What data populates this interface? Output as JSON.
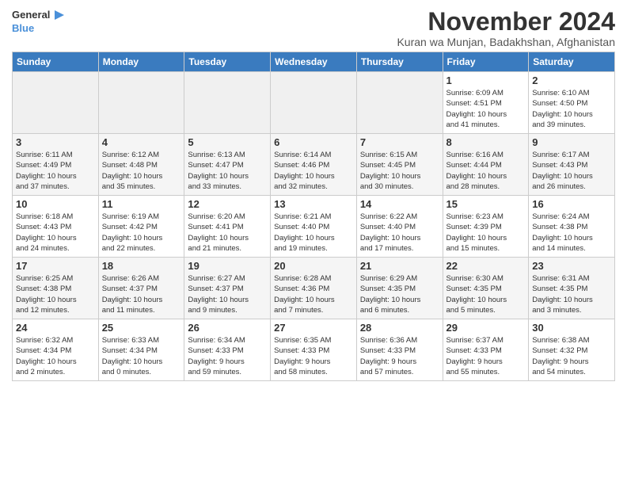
{
  "header": {
    "logo_general": "General",
    "logo_blue": "Blue",
    "month_title": "November 2024",
    "location": "Kuran wa Munjan, Badakhshan, Afghanistan"
  },
  "days_of_week": [
    "Sunday",
    "Monday",
    "Tuesday",
    "Wednesday",
    "Thursday",
    "Friday",
    "Saturday"
  ],
  "weeks": [
    [
      {
        "day": "",
        "info": ""
      },
      {
        "day": "",
        "info": ""
      },
      {
        "day": "",
        "info": ""
      },
      {
        "day": "",
        "info": ""
      },
      {
        "day": "",
        "info": ""
      },
      {
        "day": "1",
        "info": "Sunrise: 6:09 AM\nSunset: 4:51 PM\nDaylight: 10 hours\nand 41 minutes."
      },
      {
        "day": "2",
        "info": "Sunrise: 6:10 AM\nSunset: 4:50 PM\nDaylight: 10 hours\nand 39 minutes."
      }
    ],
    [
      {
        "day": "3",
        "info": "Sunrise: 6:11 AM\nSunset: 4:49 PM\nDaylight: 10 hours\nand 37 minutes."
      },
      {
        "day": "4",
        "info": "Sunrise: 6:12 AM\nSunset: 4:48 PM\nDaylight: 10 hours\nand 35 minutes."
      },
      {
        "day": "5",
        "info": "Sunrise: 6:13 AM\nSunset: 4:47 PM\nDaylight: 10 hours\nand 33 minutes."
      },
      {
        "day": "6",
        "info": "Sunrise: 6:14 AM\nSunset: 4:46 PM\nDaylight: 10 hours\nand 32 minutes."
      },
      {
        "day": "7",
        "info": "Sunrise: 6:15 AM\nSunset: 4:45 PM\nDaylight: 10 hours\nand 30 minutes."
      },
      {
        "day": "8",
        "info": "Sunrise: 6:16 AM\nSunset: 4:44 PM\nDaylight: 10 hours\nand 28 minutes."
      },
      {
        "day": "9",
        "info": "Sunrise: 6:17 AM\nSunset: 4:43 PM\nDaylight: 10 hours\nand 26 minutes."
      }
    ],
    [
      {
        "day": "10",
        "info": "Sunrise: 6:18 AM\nSunset: 4:43 PM\nDaylight: 10 hours\nand 24 minutes."
      },
      {
        "day": "11",
        "info": "Sunrise: 6:19 AM\nSunset: 4:42 PM\nDaylight: 10 hours\nand 22 minutes."
      },
      {
        "day": "12",
        "info": "Sunrise: 6:20 AM\nSunset: 4:41 PM\nDaylight: 10 hours\nand 21 minutes."
      },
      {
        "day": "13",
        "info": "Sunrise: 6:21 AM\nSunset: 4:40 PM\nDaylight: 10 hours\nand 19 minutes."
      },
      {
        "day": "14",
        "info": "Sunrise: 6:22 AM\nSunset: 4:40 PM\nDaylight: 10 hours\nand 17 minutes."
      },
      {
        "day": "15",
        "info": "Sunrise: 6:23 AM\nSunset: 4:39 PM\nDaylight: 10 hours\nand 15 minutes."
      },
      {
        "day": "16",
        "info": "Sunrise: 6:24 AM\nSunset: 4:38 PM\nDaylight: 10 hours\nand 14 minutes."
      }
    ],
    [
      {
        "day": "17",
        "info": "Sunrise: 6:25 AM\nSunset: 4:38 PM\nDaylight: 10 hours\nand 12 minutes."
      },
      {
        "day": "18",
        "info": "Sunrise: 6:26 AM\nSunset: 4:37 PM\nDaylight: 10 hours\nand 11 minutes."
      },
      {
        "day": "19",
        "info": "Sunrise: 6:27 AM\nSunset: 4:37 PM\nDaylight: 10 hours\nand 9 minutes."
      },
      {
        "day": "20",
        "info": "Sunrise: 6:28 AM\nSunset: 4:36 PM\nDaylight: 10 hours\nand 7 minutes."
      },
      {
        "day": "21",
        "info": "Sunrise: 6:29 AM\nSunset: 4:35 PM\nDaylight: 10 hours\nand 6 minutes."
      },
      {
        "day": "22",
        "info": "Sunrise: 6:30 AM\nSunset: 4:35 PM\nDaylight: 10 hours\nand 5 minutes."
      },
      {
        "day": "23",
        "info": "Sunrise: 6:31 AM\nSunset: 4:35 PM\nDaylight: 10 hours\nand 3 minutes."
      }
    ],
    [
      {
        "day": "24",
        "info": "Sunrise: 6:32 AM\nSunset: 4:34 PM\nDaylight: 10 hours\nand 2 minutes."
      },
      {
        "day": "25",
        "info": "Sunrise: 6:33 AM\nSunset: 4:34 PM\nDaylight: 10 hours\nand 0 minutes."
      },
      {
        "day": "26",
        "info": "Sunrise: 6:34 AM\nSunset: 4:33 PM\nDaylight: 9 hours\nand 59 minutes."
      },
      {
        "day": "27",
        "info": "Sunrise: 6:35 AM\nSunset: 4:33 PM\nDaylight: 9 hours\nand 58 minutes."
      },
      {
        "day": "28",
        "info": "Sunrise: 6:36 AM\nSunset: 4:33 PM\nDaylight: 9 hours\nand 57 minutes."
      },
      {
        "day": "29",
        "info": "Sunrise: 6:37 AM\nSunset: 4:33 PM\nDaylight: 9 hours\nand 55 minutes."
      },
      {
        "day": "30",
        "info": "Sunrise: 6:38 AM\nSunset: 4:32 PM\nDaylight: 9 hours\nand 54 minutes."
      }
    ]
  ]
}
